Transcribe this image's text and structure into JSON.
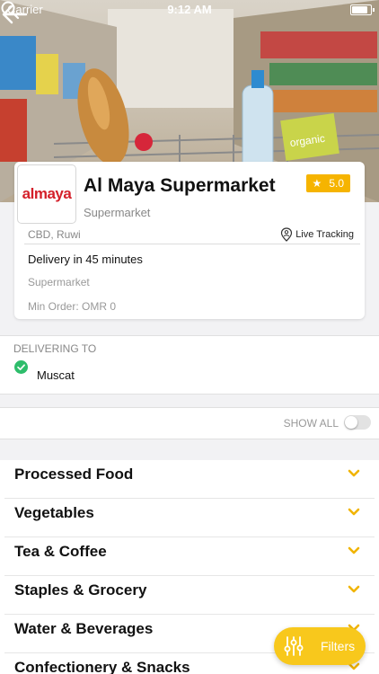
{
  "status_bar": {
    "carrier": "Carrier",
    "time": "9:12 AM"
  },
  "store": {
    "logo_text": "almaya",
    "name": "Al Maya Supermarket",
    "rating": "5.0",
    "category": "Supermarket",
    "location": "CBD, Ruwi",
    "live_tracking_label": "Live Tracking",
    "delivery_time": "Delivery in 45 minutes",
    "type": "Supermarket",
    "min_order": "Min Order: OMR 0",
    "hero_sign_text": "organic"
  },
  "delivering": {
    "label": "DELIVERING TO",
    "city": "Muscat"
  },
  "show_all": {
    "label": "SHOW ALL",
    "enabled": false
  },
  "categories": [
    {
      "label": "Processed Food"
    },
    {
      "label": "Vegetables"
    },
    {
      "label": "Tea & Coffee"
    },
    {
      "label": "Staples & Grocery"
    },
    {
      "label": "Water & Beverages"
    },
    {
      "label": "Confectionery & Snacks"
    }
  ],
  "filters_button": {
    "label": "Filters"
  },
  "colors": {
    "accent": "#f8c81c",
    "rating_bg": "#f6b400",
    "logo_red": "#d4202a",
    "check_green": "#2ebd6b"
  },
  "icons": {
    "back": "arrow-left-icon",
    "search": "search-icon",
    "star": "star-icon",
    "tracking": "location-person-icon",
    "check": "check-circle-icon",
    "chevron": "chevron-down-icon",
    "filters": "sliders-icon"
  }
}
